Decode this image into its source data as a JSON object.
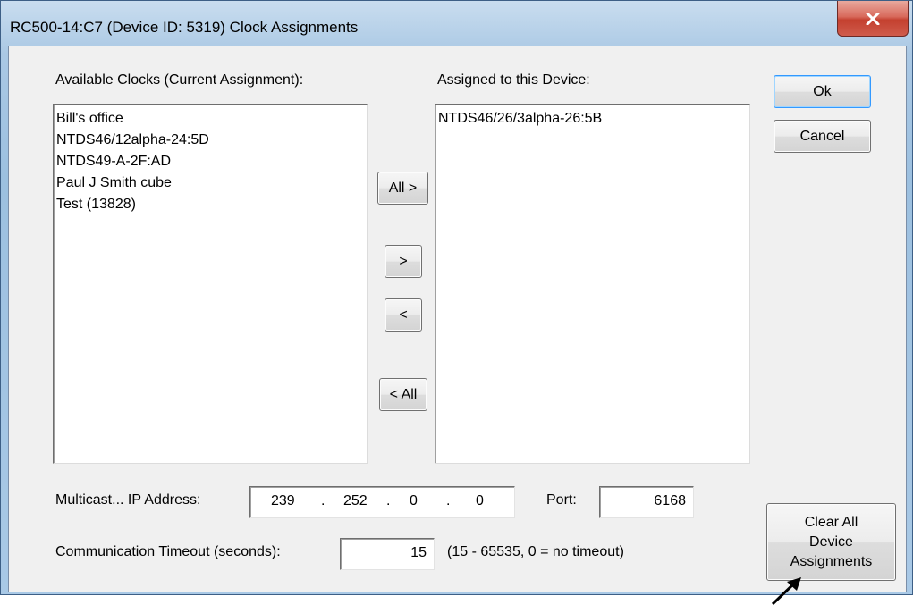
{
  "window": {
    "title": "RC500-14:C7 (Device ID: 5319) Clock Assignments",
    "close_glyph": "x"
  },
  "available": {
    "label": "Available Clocks (Current Assignment):",
    "items": [
      "Bill's office",
      "NTDS46/12alpha-24:5D",
      "NTDS49-A-2F:AD",
      "Paul J Smith cube",
      "Test (13828)"
    ]
  },
  "assigned": {
    "label": "Assigned to this Device:",
    "items": [
      "NTDS46/26/3alpha-26:5B"
    ]
  },
  "transfer": {
    "all_right": "All >",
    "one_right": ">",
    "one_left": "<",
    "all_left": "< All"
  },
  "actions": {
    "ok": "Ok",
    "cancel": "Cancel",
    "clear_all": "Clear All\nDevice\nAssignments"
  },
  "multicast": {
    "label": "Multicast...  IP Address:",
    "ip": [
      "239",
      "252",
      "0",
      "0"
    ],
    "port_label": "Port:",
    "port": "6168"
  },
  "timeout": {
    "label": "Communication Timeout (seconds):",
    "value": "15",
    "hint": "(15 - 65535, 0 = no timeout)"
  },
  "colors": {
    "frame": "#a9c9e6",
    "client": "#f0f0f0",
    "close": "#c4402f",
    "annotation_arrow": "#000000"
  }
}
